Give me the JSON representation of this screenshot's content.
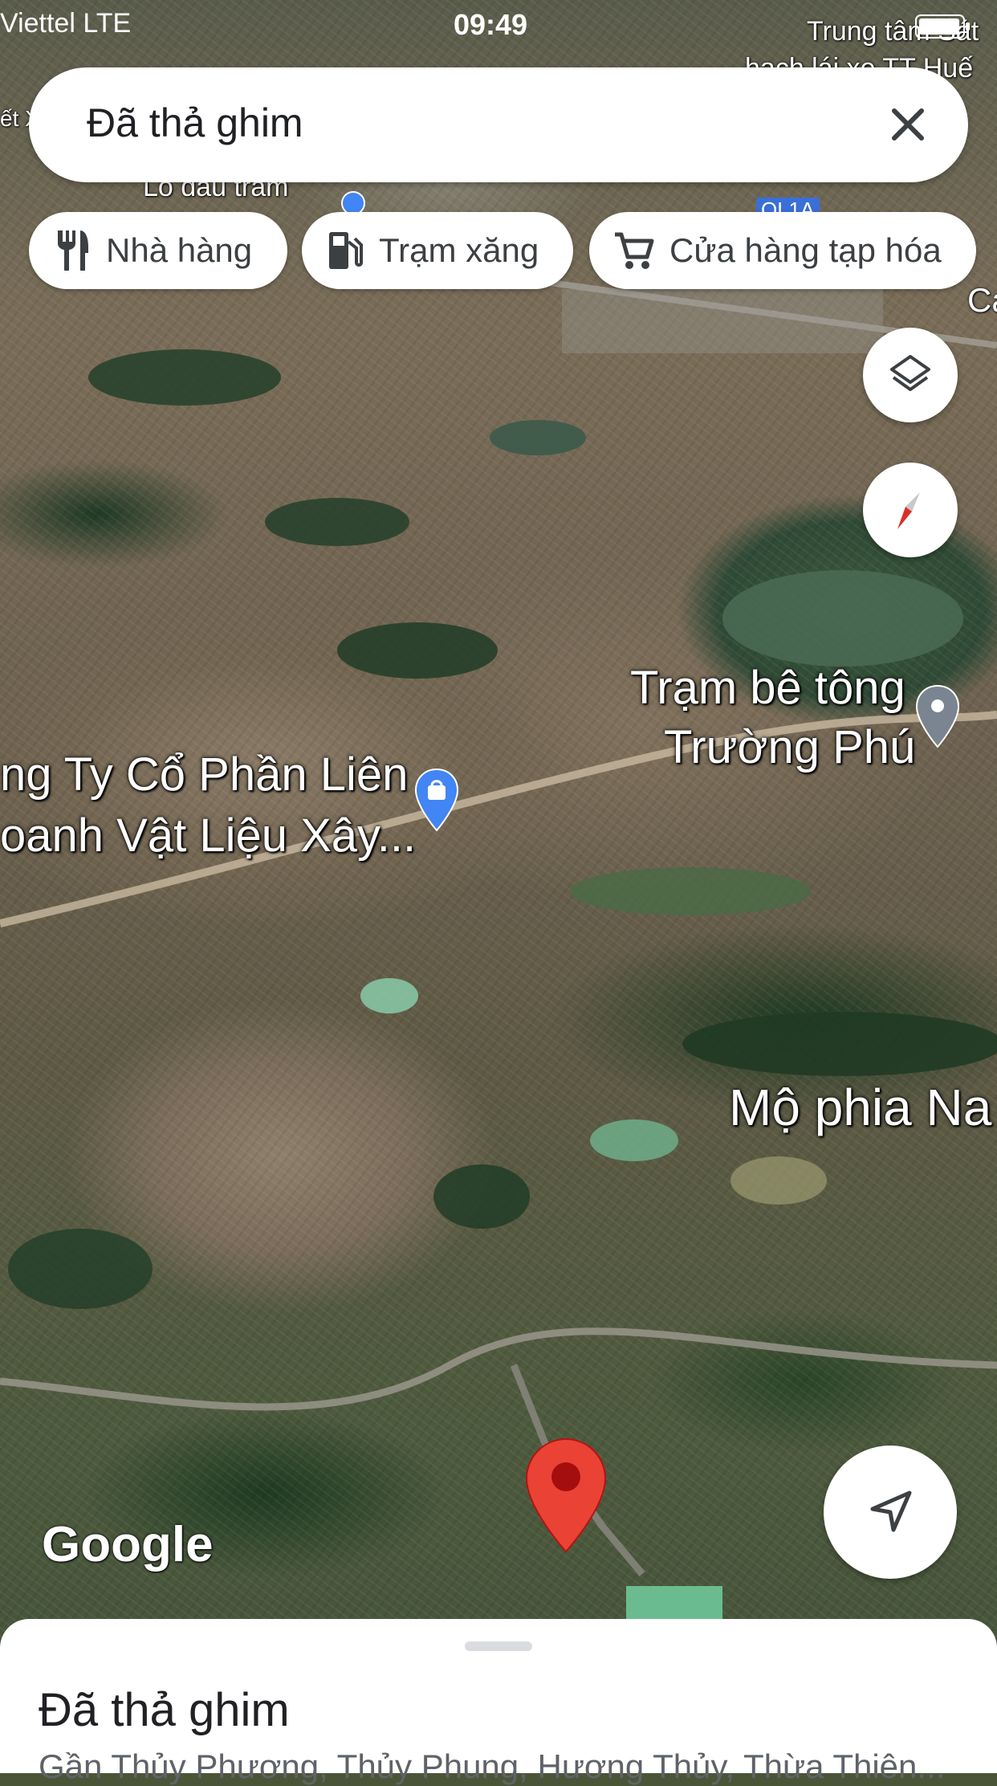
{
  "status_bar": {
    "carrier": "Viettel  LTE",
    "time": "09:49"
  },
  "search": {
    "query": "Đã thả ghim"
  },
  "chips": [
    {
      "label": "Nhà hàng",
      "icon": "restaurant-icon"
    },
    {
      "label": "Trạm xăng",
      "icon": "gas-station-icon"
    },
    {
      "label": "Cửa hàng tạp hóa",
      "icon": "shopping-cart-icon"
    }
  ],
  "map": {
    "labels": {
      "truong_tam": "Trung tâm Sát",
      "tt_hue": "hạch lái xe TT Huế",
      "lo_dau": "Lò đầu trăm",
      "ql1a": "QL1A",
      "tram_be_tong_1": "Trạm bê tông",
      "tram_be_tong_2": "Trường Phú",
      "cong_ty_1": "ng Ty Cổ Phần Liên",
      "cong_ty_2": "oanh Vật Liệu Xây...",
      "mo_phia": "Mộ phia Na",
      "edge_ca": "Ca",
      "edge_left": "ết X"
    },
    "watermark": "Google"
  },
  "bottom_sheet": {
    "title": "Đã thả ghim",
    "subtitle": "Gần Thủy Phương, Thủy Phung, Hương Thủy, Thừa Thiên..."
  },
  "colors": {
    "pin": "#ea4335",
    "poi_blue": "#4285f4",
    "poi_gray": "#7a8591"
  }
}
